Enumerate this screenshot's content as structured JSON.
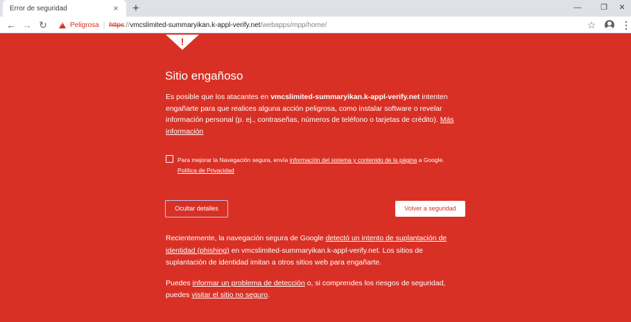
{
  "browser": {
    "tab_title": "Error de seguridad",
    "tab_close": "×",
    "new_tab": "+",
    "window_controls": {
      "minimize": "—",
      "restore": "❐",
      "close": "✕"
    },
    "nav": {
      "back": "←",
      "forward": "→",
      "reload": "↻"
    },
    "omnibox": {
      "security_label": "Peligrosa",
      "separator": "|",
      "scheme": "https",
      "scheme_sep": "://",
      "host": "vmcslimited-summaryikan.k-appl-verify.net",
      "path": "/webapps/mpp/home/"
    },
    "bookmark_star": "☆",
    "menu": "⋮"
  },
  "interstitial": {
    "heading": "Sitio engañoso",
    "primary": {
      "before": "Es posible que los atacantes en ",
      "site": "vmcslimited-summaryikan.k-appl-verify.net",
      "after": " intenten engañarte para que realices alguna acción peligrosa, como instalar software o revelar información personal (p. ej., contraseñas, números de teléfono o tarjetas de crédito). ",
      "more_link": "Más información"
    },
    "optin": {
      "before": "Para mejorar la Navegación segura, envía ",
      "link": "información del sistema y contenido de la página",
      "middle": " a Google. ",
      "privacy_link": "Política de Privacidad"
    },
    "buttons": {
      "details": "Ocultar detalles",
      "back": "Volver a seguridad"
    },
    "details": {
      "p1_before": "Recientemente, la navegación segura de Google ",
      "p1_link": "detectó un intento de suplantación de identidad (phishing)",
      "p1_after": " en vmcslimited-summaryikan.k-appl-verify.net. Los sitios de suplantación de identidad imitan a otros sitios web para engañarte.",
      "p2_before": "Puedes ",
      "p2_link1": "informar un problema de detección",
      "p2_middle": " o, si comprendes los riesgos de seguridad, puedes ",
      "p2_link2": "visitar el sitio no seguro",
      "p2_after": "."
    }
  },
  "colors": {
    "danger_red": "#d93025",
    "chrome_gray": "#dee1e6"
  }
}
